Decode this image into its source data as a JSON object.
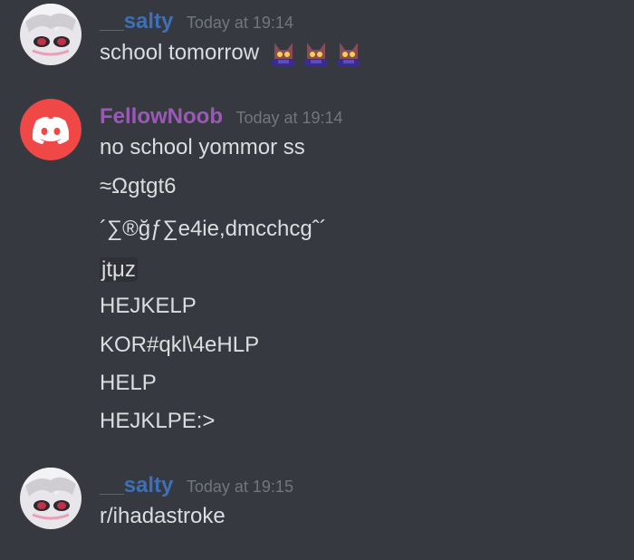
{
  "messages": [
    {
      "user": "__salty",
      "user_color": "#3e6fb8",
      "timestamp": "Today at 19:14",
      "avatar": "anime-avatar-icon",
      "lines": [
        "school tomorrow"
      ],
      "emojis": [
        "sad-cat-emoji",
        "sad-cat-emoji",
        "sad-cat-emoji"
      ]
    },
    {
      "user": "FellowNoob",
      "user_color": "#9b59b6",
      "timestamp": "Today at 19:14",
      "avatar": "discord-logo-icon",
      "lines": [
        "no school yommor ss",
        "≈Ωgtgt6",
        "´∑®ğƒ∑e4ie,dmcchcgˆ´",
        "jtμz",
        "HEJKELP",
        "KOR#qkl\\4eHLP",
        "HELP",
        "HEJKLPE:>"
      ]
    },
    {
      "user": "__salty",
      "user_color": "#3e6fb8",
      "timestamp": "Today at 19:15",
      "avatar": "anime-avatar-icon",
      "lines": [
        "r/ihadastroke"
      ]
    }
  ],
  "colors": {
    "background": "#36393f",
    "text": "#dcddde",
    "timestamp": "#72767d",
    "discord_blurple_red": "#f04747"
  }
}
